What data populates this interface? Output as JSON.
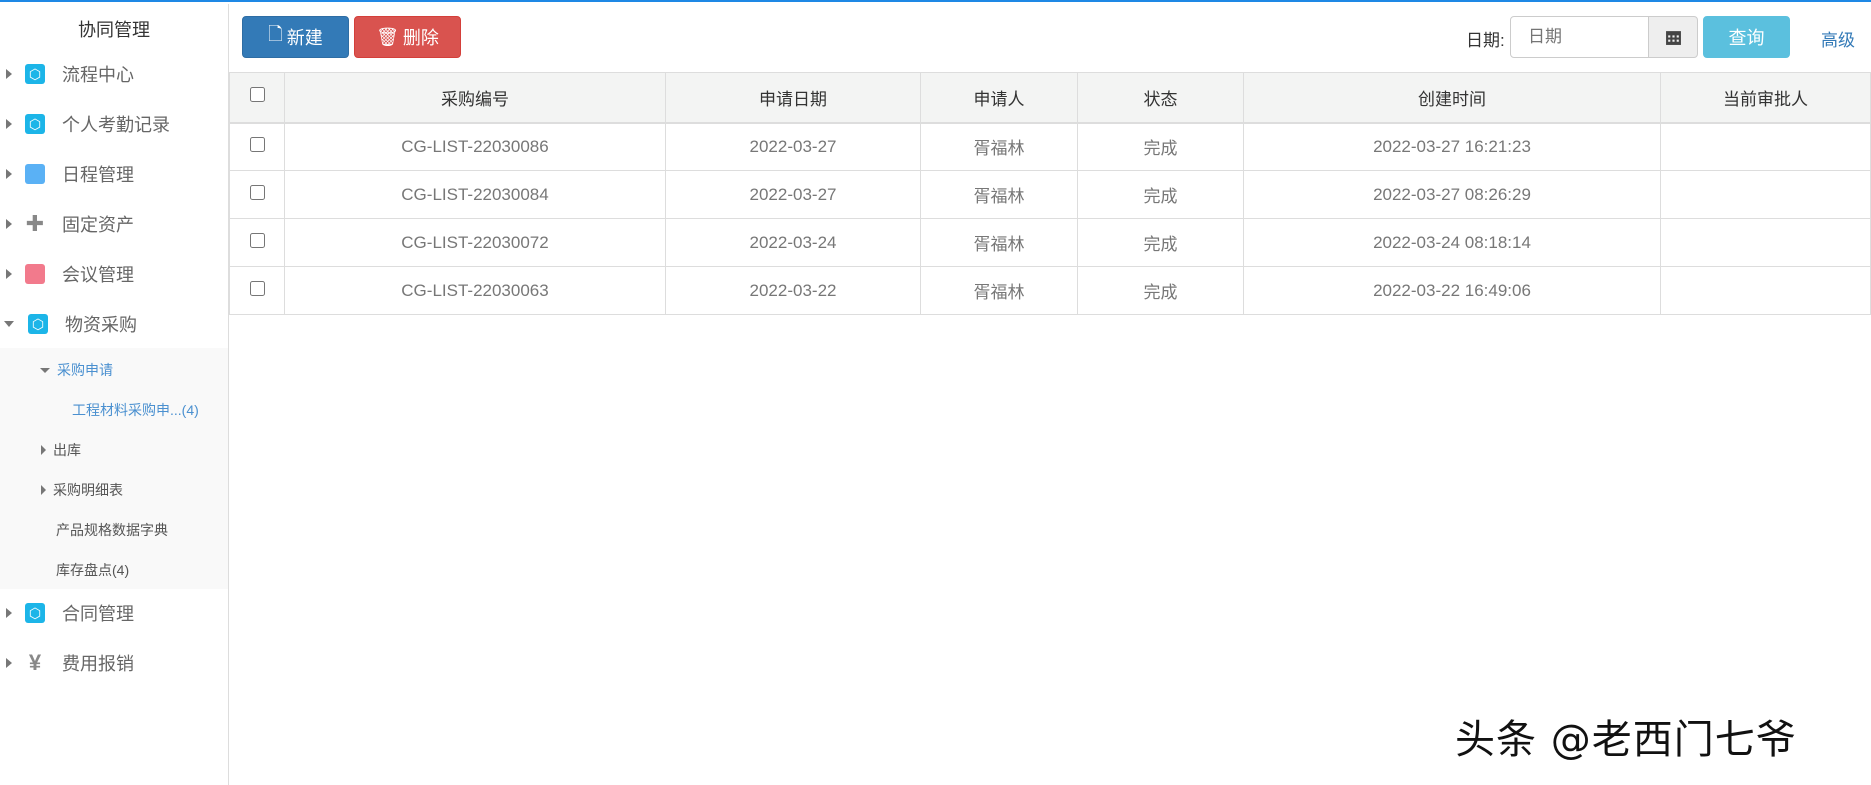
{
  "sidebar": {
    "title": "协同管理",
    "items": [
      {
        "label": "流程中心"
      },
      {
        "label": "个人考勤记录"
      },
      {
        "label": "日程管理"
      },
      {
        "label": "固定资产"
      },
      {
        "label": "会议管理"
      },
      {
        "label": "物资采购"
      },
      {
        "label": "合同管理"
      },
      {
        "label": "费用报销"
      }
    ],
    "sub": [
      {
        "label": "采购申请"
      },
      {
        "label": "工程材料采购申...(4)"
      },
      {
        "label": "出库"
      },
      {
        "label": "采购明细表"
      },
      {
        "label": "产品规格数据字典"
      },
      {
        "label": "库存盘点(4)"
      }
    ],
    "yen": "¥"
  },
  "toolbar": {
    "new_label": "新建",
    "delete_label": "删除",
    "date_label": "日期:",
    "date_placeholder": "日期",
    "query_label": "查询",
    "advanced_label": "高级"
  },
  "table": {
    "headers": [
      "采购编号",
      "申请日期",
      "申请人",
      "状态",
      "创建时间",
      "当前审批人"
    ],
    "rows": [
      [
        "CG-LIST-22030086",
        "2022-03-27",
        "胥福林",
        "完成",
        "2022-03-27 16:21:23",
        ""
      ],
      [
        "CG-LIST-22030084",
        "2022-03-27",
        "胥福林",
        "完成",
        "2022-03-27 08:26:29",
        ""
      ],
      [
        "CG-LIST-22030072",
        "2022-03-24",
        "胥福林",
        "完成",
        "2022-03-24 08:18:14",
        ""
      ],
      [
        "CG-LIST-22030063",
        "2022-03-22",
        "胥福林",
        "完成",
        "2022-03-22 16:49:06",
        ""
      ]
    ]
  },
  "watermark": "头条 @老西门七爷"
}
